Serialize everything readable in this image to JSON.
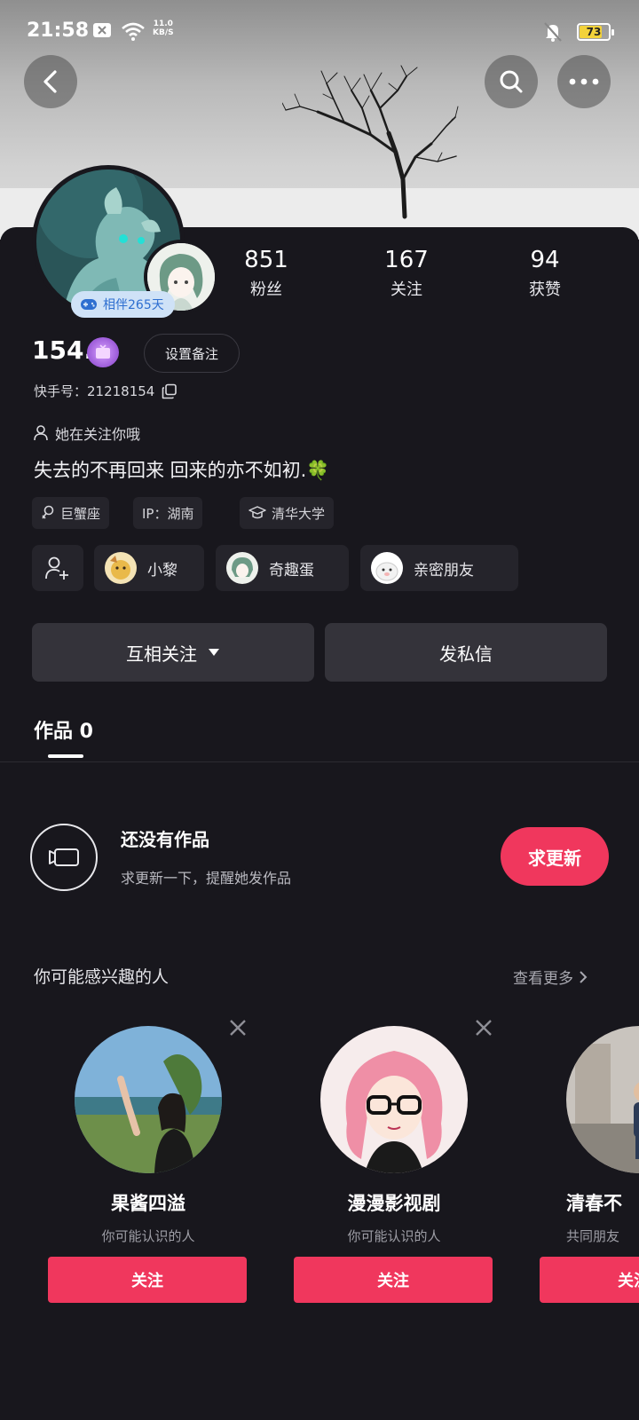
{
  "status_bar": {
    "time": "21:58",
    "net_speed_value": "11.0",
    "net_speed_unit": "KB/S",
    "battery": "73",
    "battery_level": 0.73,
    "icons": [
      "notification-x-icon",
      "wifi-icon",
      "mute-bell-icon",
      "battery-icon"
    ]
  },
  "header": {
    "back_icon": "chevron-left-icon",
    "search_icon": "search-icon",
    "more_icon": "more-dots-icon"
  },
  "profile": {
    "companion_badge": "相伴265天",
    "nickname": "154.",
    "remark_button": "设置备注",
    "account_id": "快手号：21218154",
    "follow_hint": "她在关注你哦",
    "bio": "失去的不再回来 回来的亦不如初.",
    "bio_emoji": "🍀",
    "stats": [
      {
        "num": "851",
        "label": "粉丝"
      },
      {
        "num": "167",
        "label": "关注"
      },
      {
        "num": "94",
        "label": "获赞"
      }
    ],
    "tags": [
      {
        "icon": "female-icon",
        "label": "巨蟹座"
      },
      {
        "icon": "",
        "label": "IP：湖南"
      },
      {
        "icon": "graduation-cap-icon",
        "label": "清华大学"
      }
    ],
    "friends": [
      {
        "name": "小黎"
      },
      {
        "name": "奇趣蛋"
      },
      {
        "name": "亲密朋友"
      }
    ]
  },
  "actions": {
    "mutual_follow": "互相关注",
    "message": "发私信"
  },
  "tabs": {
    "works": "作品 0"
  },
  "empty_state": {
    "title": "还没有作品",
    "subtitle": "求更新一下，提醒她发作品",
    "button": "求更新"
  },
  "recommend": {
    "title": "你可能感兴趣的人",
    "more": "查看更多",
    "cards": [
      {
        "name": "果酱四溢",
        "reason": "你可能认识的人",
        "button": "关注"
      },
      {
        "name": "漫漫影视剧",
        "reason": "你可能认识的人",
        "button": "关注"
      },
      {
        "name": "清春不",
        "reason": "共同朋友",
        "button": "关注"
      }
    ]
  },
  "colors": {
    "background": "#18171d",
    "accent": "#f0375d",
    "button_dark": "#34333a",
    "chip": "#25242b"
  }
}
